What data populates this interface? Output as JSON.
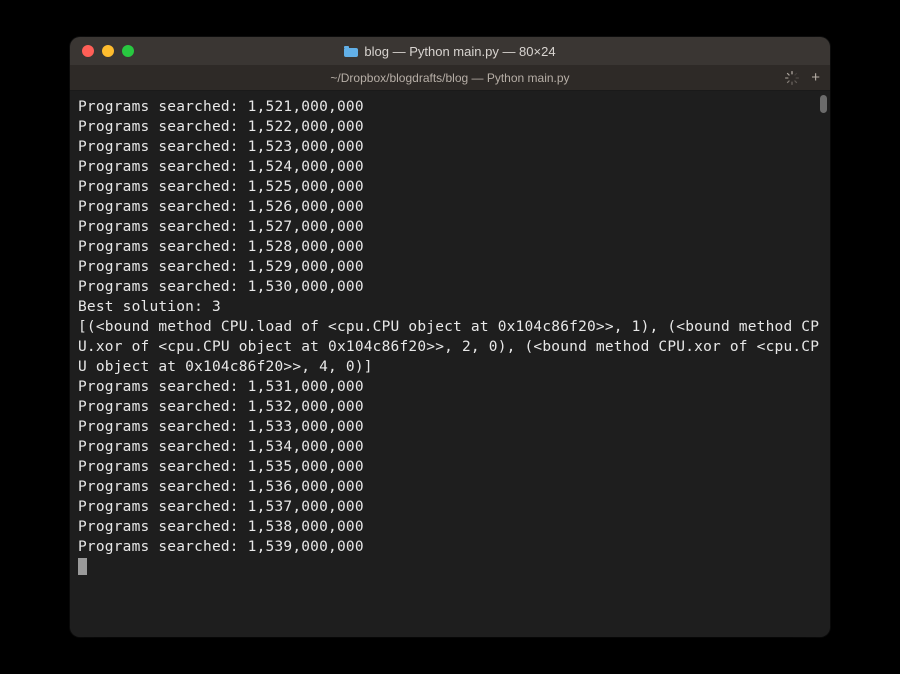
{
  "window": {
    "title": "blog — Python main.py — 80×24"
  },
  "tab": {
    "label": "~/Dropbox/blogdrafts/blog — Python main.py"
  },
  "terminal": {
    "lines": [
      "Programs searched: 1,521,000,000",
      "Programs searched: 1,522,000,000",
      "Programs searched: 1,523,000,000",
      "Programs searched: 1,524,000,000",
      "Programs searched: 1,525,000,000",
      "Programs searched: 1,526,000,000",
      "Programs searched: 1,527,000,000",
      "Programs searched: 1,528,000,000",
      "Programs searched: 1,529,000,000",
      "Programs searched: 1,530,000,000",
      "Best solution: 3",
      "[(<bound method CPU.load of <cpu.CPU object at 0x104c86f20>>, 1), (<bound method CPU.xor of <cpu.CPU object at 0x104c86f20>>, 2, 0), (<bound method CPU.xor of <cpu.CPU object at 0x104c86f20>>, 4, 0)]",
      "Programs searched: 1,531,000,000",
      "Programs searched: 1,532,000,000",
      "Programs searched: 1,533,000,000",
      "Programs searched: 1,534,000,000",
      "Programs searched: 1,535,000,000",
      "Programs searched: 1,536,000,000",
      "Programs searched: 1,537,000,000",
      "Programs searched: 1,538,000,000",
      "Programs searched: 1,539,000,000"
    ]
  },
  "icons": {
    "close": "close",
    "minimize": "minimize",
    "maximize": "maximize",
    "folder": "folder",
    "spinner": "loading-spinner",
    "plus": "+"
  },
  "colors": {
    "bg": "#1e1e1e",
    "titlebar": "#3a3633",
    "tabbar": "#2e2a27",
    "text": "#e8e8e8",
    "close": "#ff5f57",
    "min": "#febc2e",
    "max": "#28c840"
  }
}
